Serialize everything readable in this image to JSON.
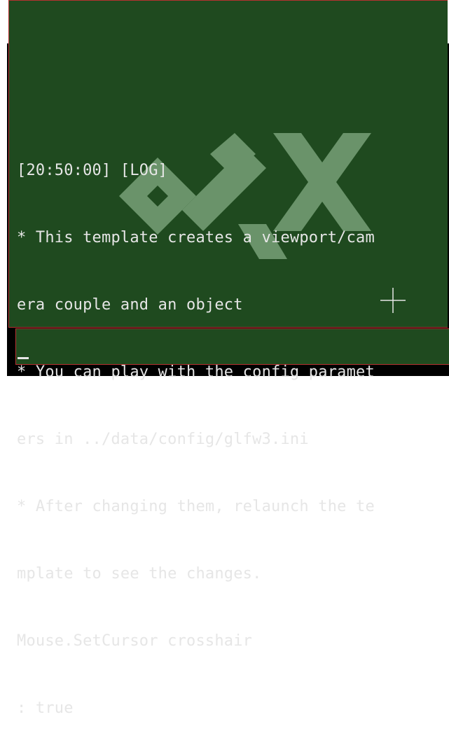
{
  "window": {
    "icon": "app-window-icon",
    "controls": {
      "minimize_icon": "minimize-icon",
      "maximize_icon": "maximize-icon",
      "close_icon": "close-icon"
    }
  },
  "console": {
    "log_lines": [
      "[20:50:00] [LOG]",
      "* This template creates a viewport/cam",
      "era couple and an object",
      "* You can play with the config paramet",
      "ers in ../data/config/glfw3.ini",
      "* After changing them, relaunch the te",
      "mplate to see the changes.",
      "Mouse.SetCursor crosshair",
      ": true"
    ],
    "input_value": "",
    "colors": {
      "background": "#1f4a1f",
      "border": "#b53131",
      "text": "#e6e6e6",
      "watermark": "#9ec79e"
    },
    "watermark_icon": "orx-logo-watermark",
    "cursor_icon": "crosshair-cursor-icon"
  }
}
